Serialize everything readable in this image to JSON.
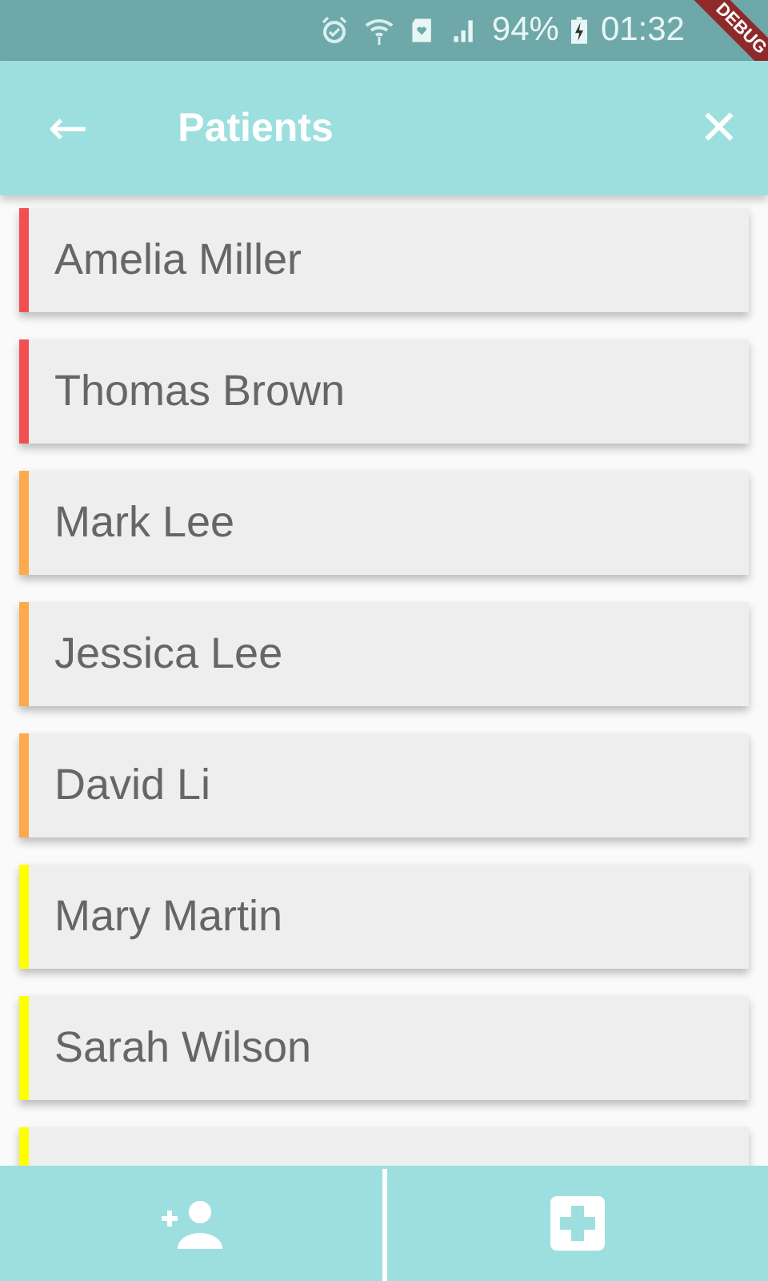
{
  "status_bar": {
    "battery": "94%",
    "time": "01:32"
  },
  "debug_banner": "DEBUG",
  "app_bar": {
    "back": "←",
    "title": "Patients",
    "close": "✕"
  },
  "patients": [
    {
      "name": "Amelia Miller",
      "color": "#f25050"
    },
    {
      "name": "Thomas Brown",
      "color": "#f25050"
    },
    {
      "name": "Mark Lee",
      "color": "#ffa94d"
    },
    {
      "name": "Jessica Lee",
      "color": "#ffa94d"
    },
    {
      "name": "David Li",
      "color": "#ffa94d"
    },
    {
      "name": "Mary Martin",
      "color": "#ffff00"
    },
    {
      "name": "Sarah Wilson",
      "color": "#ffff00"
    },
    {
      "color": "#ffff00"
    }
  ]
}
